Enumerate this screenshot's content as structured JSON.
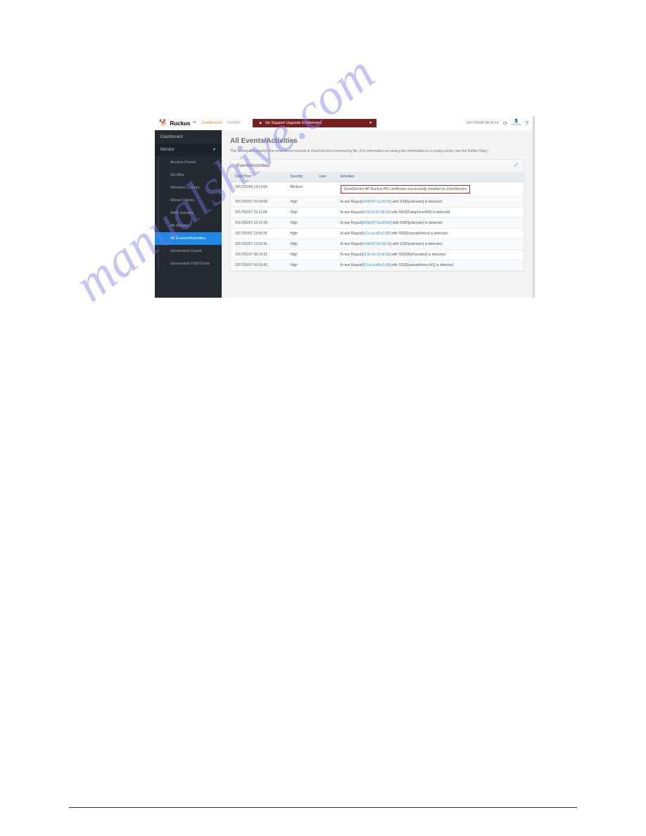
{
  "watermark": "manualshive.com",
  "topbar": {
    "logo_text": "Ruckus",
    "logo_sub": "ZoneDirector",
    "device": "ZD1200",
    "banner_text": "No Support Upgrade Entitlement.",
    "timestamp": "2017/02/08 14:14:10",
    "user_label": "ruckus"
  },
  "sidebar": {
    "dashboard": "Dashboard",
    "monitor": "Monitor",
    "items": [
      "Access Points",
      "WLANs",
      "Wireless Clients",
      "Wired Clients",
      "AAA Servers",
      "All Alarms",
      "All Events/Activities",
      "Generated Guest",
      "Generated PSK/Certs"
    ]
  },
  "content": {
    "title": "All Events/Activities",
    "description": "This workspace displays the most recent records in ZoneDirector's internal log file. (For information on saving this information to a syslog server, see the Online Help.)",
    "panel_title": "Events/Activities",
    "columns": [
      "Date/Time",
      "Severity",
      "User",
      "Activities"
    ],
    "rows": [
      {
        "dt": "2017/02/08 14:13:05",
        "sev": "Medium",
        "user": "",
        "act_pre": "",
        "act_link": "",
        "act_post": "ZoneDirector AP Ruckus PKI certificates successfully installed on ZoneDirector",
        "hl": true
      },
      {
        "dt": "2017/02/07 22:24:06",
        "sev": "High",
        "user": "",
        "act_pre": "A new Rogue[",
        "act_link": "c4:8d:97:1a:35:41",
        "act_post": "] with SSID[unknown] is detected"
      },
      {
        "dt": "2017/02/07 21:11:08",
        "sev": "High",
        "user": "",
        "act_pre": "A new Rogue[",
        "act_link": "bc:5f:e3:01:08:a2",
        "act_post": "] with SSID[DataphoneWifi] is detected"
      },
      {
        "dt": "2017/02/07 16:12:43",
        "sev": "High",
        "user": "",
        "act_pre": "A new Rogue[",
        "act_link": "09:8d:97:0a:34:b1",
        "act_post": "] with SSID[unknown] is detected"
      },
      {
        "dt": "2017/02/07 13:06:41",
        "sev": "High",
        "user": "",
        "act_pre": "A new Rogue[",
        "act_link": "fd:1a:ca:d9:e1:00",
        "act_post": "] with SSID[cairoathletics] is detected"
      },
      {
        "dt": "2017/02/07 12:22:41",
        "sev": "High",
        "user": "",
        "act_pre": "A new Rogue[",
        "act_link": "c4:8d:97:0a:35:41",
        "act_post": "] with SSID[unknown] is detected"
      },
      {
        "dt": "2017/02/07 08:19:21",
        "sev": "High",
        "user": "",
        "act_pre": "A new Rogue[",
        "act_link": "b1:8c:5e:15:bf:a0",
        "act_post": "] with SSID[MyParadise] is detected"
      },
      {
        "dt": "2017/02/07 06:10:43",
        "sev": "High",
        "user": "",
        "act_pre": "A new Rogue[",
        "act_link": "f8:1a:ca:d9:e1:05",
        "act_post": "] with SSID[cairoathletics-5G] is detected"
      }
    ]
  }
}
